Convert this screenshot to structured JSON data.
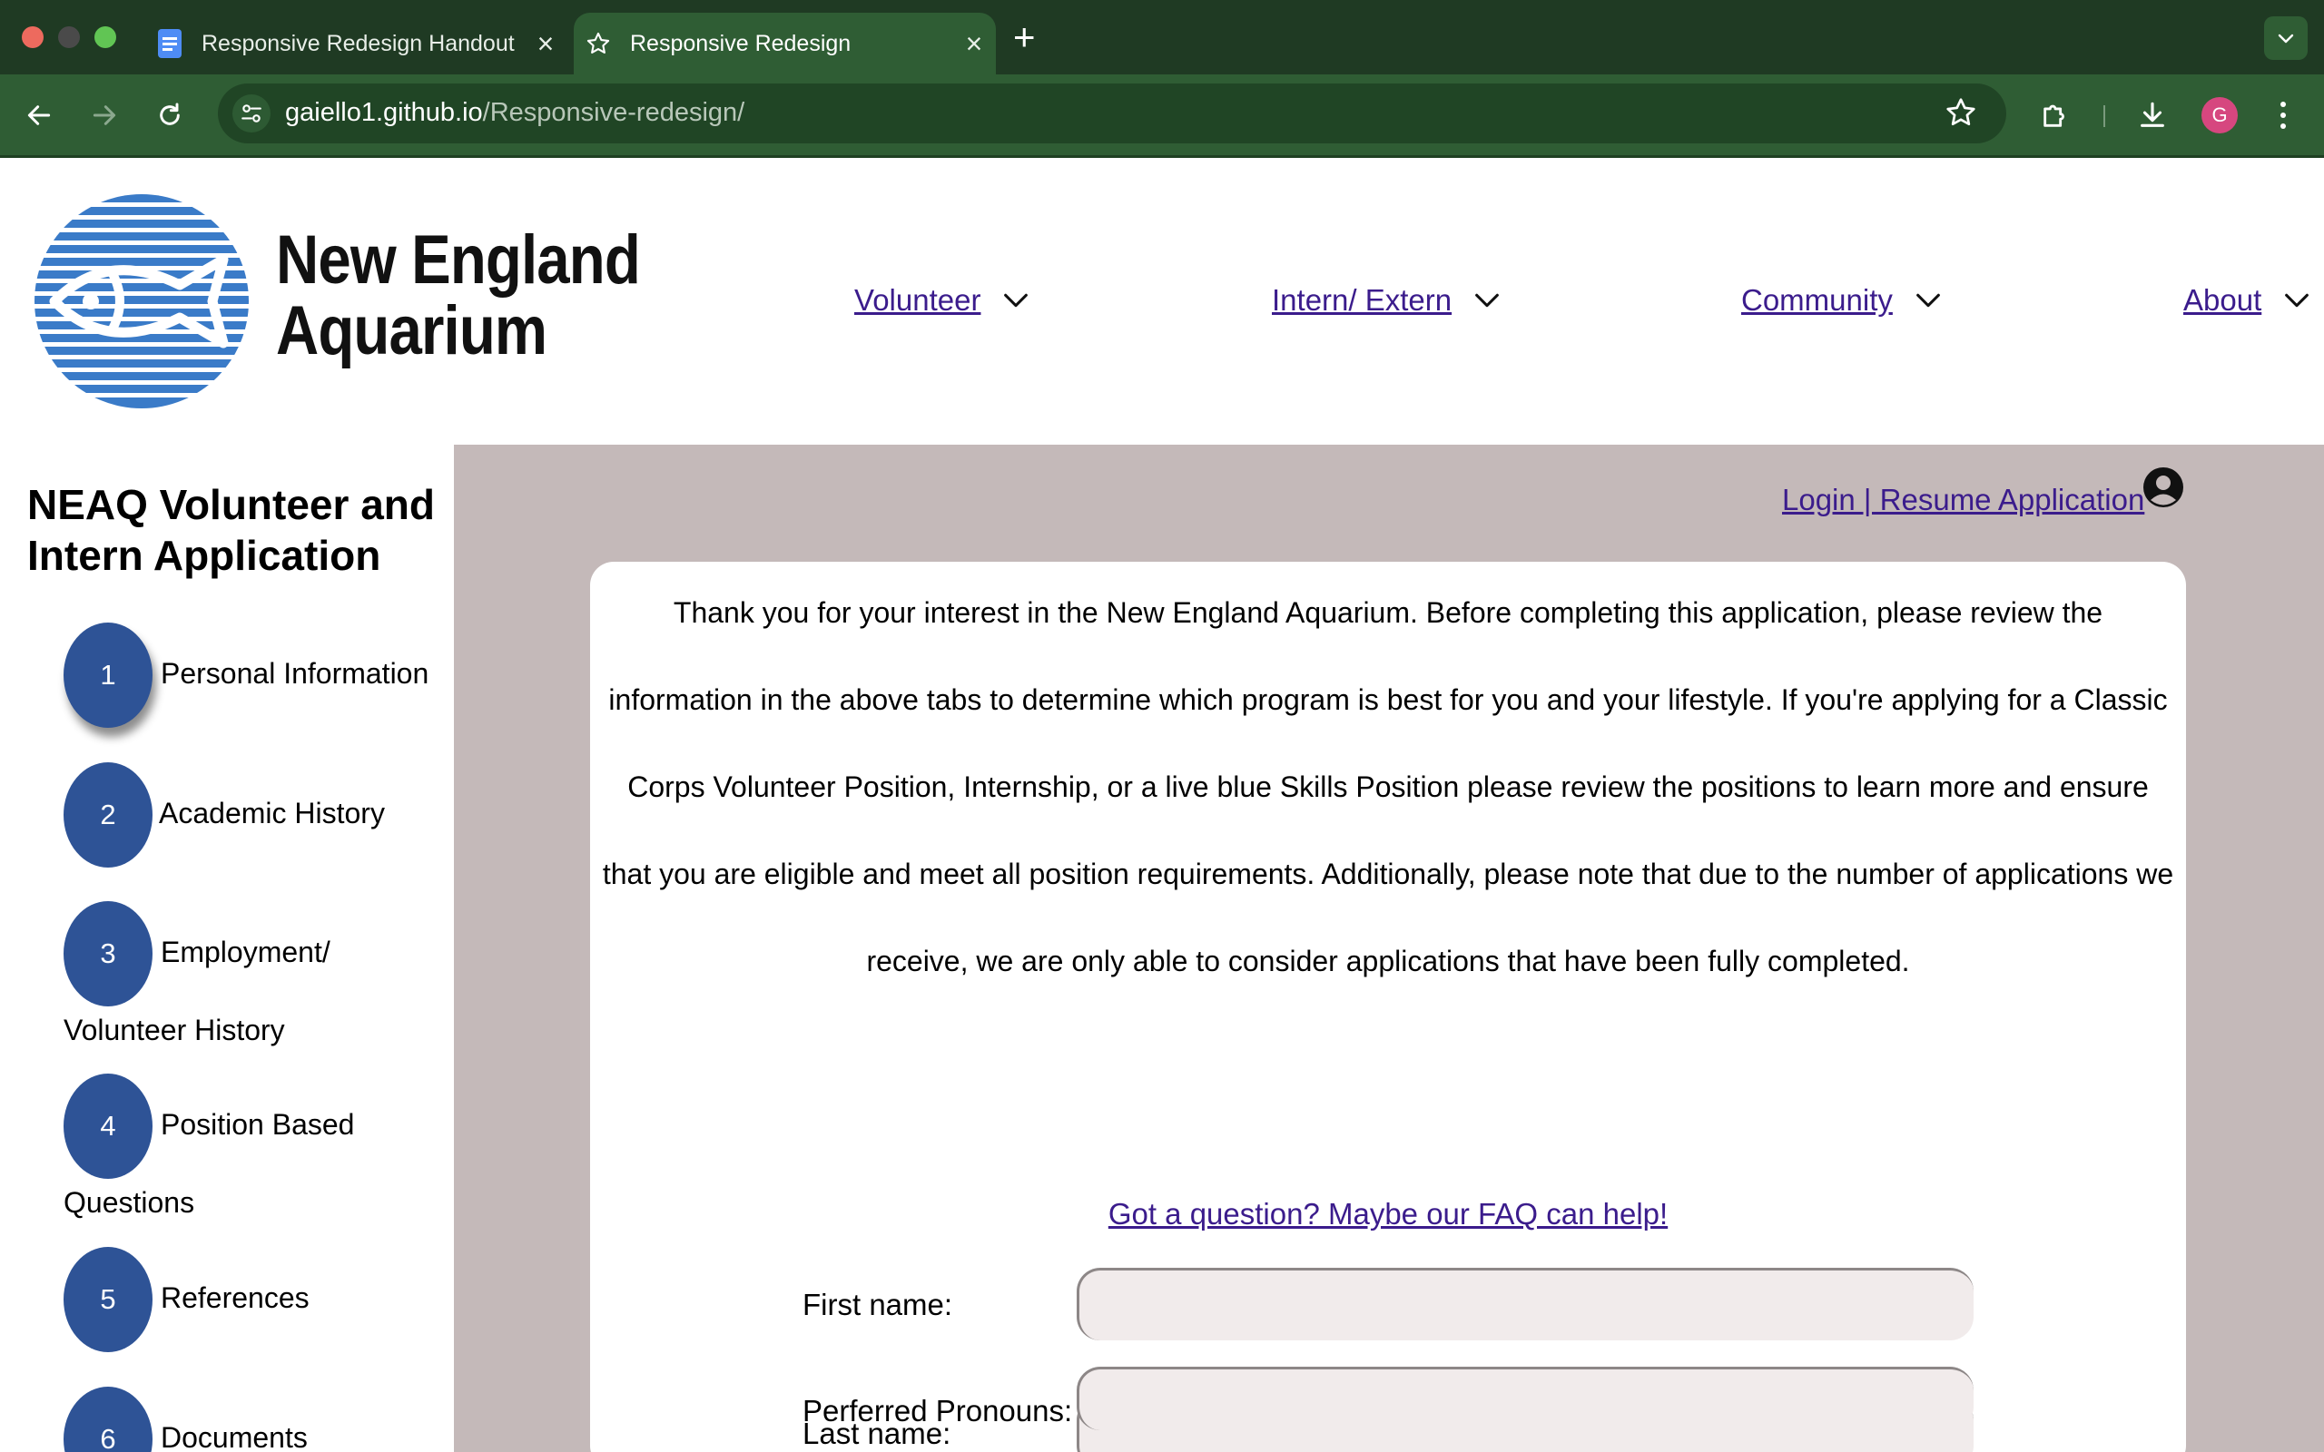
{
  "browser": {
    "tabs": [
      {
        "title": "Responsive Redesign Handout",
        "favicon": "docs-icon",
        "active": false
      },
      {
        "title": "Responsive Redesign",
        "favicon": "star-icon",
        "active": true
      }
    ],
    "url_host": "gaiello1.github.io",
    "url_path": "/Responsive-redesign/",
    "profile_initial": "G",
    "colors": {
      "frame": "#1f3a23",
      "toolbar": "#2f5d34",
      "omnibox": "#204525",
      "profile": "#d6477f"
    }
  },
  "header": {
    "brand_line1": "New England",
    "brand_line2": "Aquarium",
    "logo": "fish-logo-icon",
    "nav": [
      {
        "label": "Volunteer"
      },
      {
        "label": "Intern/ Extern"
      },
      {
        "label": "Community"
      },
      {
        "label": "About"
      }
    ]
  },
  "sidebar": {
    "title": "NEAQ Volunteer and Intern Application",
    "steps": [
      {
        "number": "1",
        "label_line1": "Personal Information",
        "label_line2": ""
      },
      {
        "number": "2",
        "label_line1": "Academic History",
        "label_line2": ""
      },
      {
        "number": "3",
        "label_line1": "Employment/",
        "label_line2": "Volunteer History"
      },
      {
        "number": "4",
        "label_line1": "Position Based",
        "label_line2": "Questions"
      },
      {
        "number": "5",
        "label_line1": "References",
        "label_line2": ""
      },
      {
        "number": "6",
        "label_line1": "Documents",
        "label_line2": ""
      }
    ]
  },
  "main": {
    "login_link": "Login | Resume Application",
    "intro": "Thank you for your interest in the New England Aquarium. Before completing this application, please review the information in the above tabs to determine which program is best for you and your lifestyle. If you're applying for a Classic Corps Volunteer Position, Internship, or a live blue Skills Position please review the positions to learn more and ensure that you are eligible and meet all position requirements. Additionally, please note that due to the number of applications we receive, we are only able to consider applications that have been fully completed.",
    "faq_link": "Got a question? Maybe our FAQ can help!",
    "fields": [
      {
        "label": "First name:",
        "value": ""
      },
      {
        "label": "Last name:",
        "value": ""
      },
      {
        "label": "Perferred Pronouns:",
        "value": ""
      }
    ]
  },
  "colors": {
    "step_circle": "#2e5396",
    "content_background": "#c4b9b9",
    "link": "#3b1c8c",
    "input_background": "#f1ebeb",
    "logo_blue": "#3a7bc8"
  }
}
